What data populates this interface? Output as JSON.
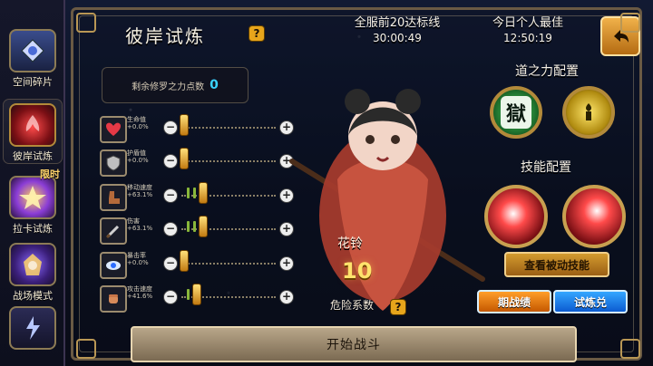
{
  "nav": {
    "items": [
      {
        "label": "空间碎片",
        "icon": "space-shards-icon"
      },
      {
        "label": "彼岸试炼",
        "icon": "red-lotus-icon",
        "active": true
      },
      {
        "label": "拉卡试炼",
        "icon": "raka-trial-icon",
        "badge": "限时"
      },
      {
        "label": "战场模式",
        "icon": "battlefield-icon"
      },
      {
        "label": "",
        "icon": "lightning-icon"
      }
    ]
  },
  "header": {
    "title": "彼岸试炼",
    "help": "?",
    "timer1_label": "全服前20达标线",
    "timer1_value": "30:00:49",
    "timer2_label": "今日个人最佳",
    "timer2_value": "12:50:19"
  },
  "points": {
    "label": "剩余修罗之力点数",
    "value": "0"
  },
  "stats": [
    {
      "name": "生命值",
      "pct": "+0.0%",
      "icon": "heart-icon",
      "pips": 0
    },
    {
      "name": "护盾值",
      "pct": "+0.0%",
      "icon": "shield-icon",
      "pips": 0
    },
    {
      "name": "移动速度",
      "pct": "+63.1%",
      "icon": "boot-icon",
      "pips": 3
    },
    {
      "name": "伤害",
      "pct": "+63.1%",
      "icon": "sword-icon",
      "pips": 3
    },
    {
      "name": "暴击率",
      "pct": "+0.0%",
      "icon": "eye-icon",
      "pips": 0
    },
    {
      "name": "攻击速度",
      "pct": "+41.6%",
      "icon": "fist-icon",
      "pips": 2
    }
  ],
  "hero": {
    "name": "花铃",
    "level": "10",
    "danger_label": "危险系数",
    "help": "?"
  },
  "right": {
    "dao_title": "道之力配置",
    "skill_title": "技能配置",
    "dao_icons": [
      "prison-glyph-icon",
      "spirit-glyph-icon"
    ],
    "dao_glyph": "獄",
    "skill_icons": [
      "red-vortex-skill-icon",
      "red-nova-skill-icon"
    ],
    "passive_button": "查看被动技能",
    "record_button": "期战绩",
    "exchange_button": "试炼兑"
  },
  "start_button": "开始战斗",
  "colors": {
    "accent_gold": "#e7a51b",
    "frame": "#6a5a44",
    "cyan": "#3ad3ff"
  }
}
